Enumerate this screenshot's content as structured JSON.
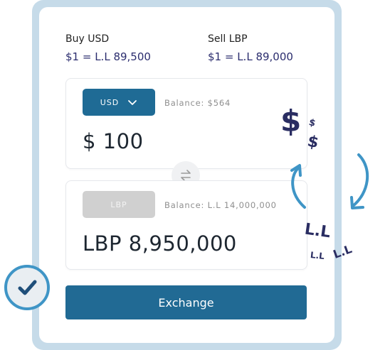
{
  "rates": {
    "buy_label": "Buy USD",
    "buy_value": "$1 = L.L 89,500",
    "sell_label": "Sell LBP",
    "sell_value": "$1 = L.L 89,000"
  },
  "from": {
    "currency": "USD",
    "balance": "Balance: $564",
    "amount": "$ 100"
  },
  "to": {
    "currency": "LBP",
    "balance": "Balance: L.L 14,000,000",
    "amount": "LBP 8,950,000"
  },
  "actions": {
    "exchange_label": "Exchange"
  },
  "decor": {
    "dollar": "$",
    "lira": "L.L"
  },
  "icons": [
    "chevron-down-icon",
    "swap-arrows-icon",
    "check-icon",
    "cycle-arrows-icon"
  ],
  "colors": {
    "primary": "#216a94",
    "text_accent": "#2b2d6e",
    "frame": "#c6dbe9",
    "check_ring": "#3f95c6"
  }
}
